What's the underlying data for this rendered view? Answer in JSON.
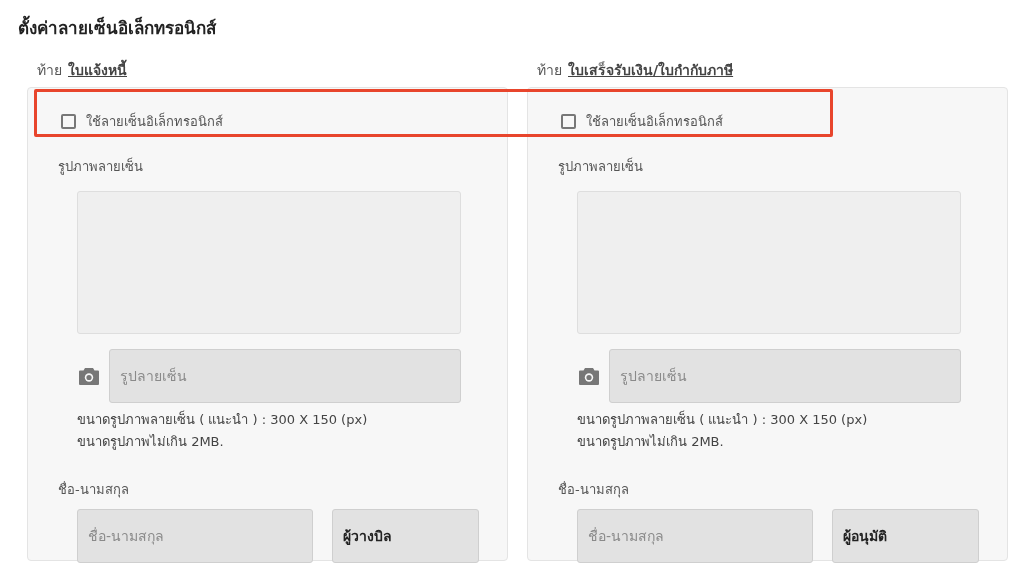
{
  "title": "ตั้งค่าลายเซ็นอิเล็กทรอนิกส์",
  "sections": [
    {
      "prefix": "ท้าย",
      "document": "ใบแจ้งหนี้",
      "use_signature": {
        "label": "ใช้ลายเซ็นอิเล็กทรอนิกส์",
        "checked": false
      },
      "image_label": "รูปภาพลายเซ็น",
      "image_field": {
        "placeholder": "รูปลายเซ็น"
      },
      "hints": [
        "ขนาดรูปภาพลายเซ็น ( แนะนำ ) : 300 X 150 (px)",
        "ขนาดรูปภาพไม่เกิน 2MB."
      ],
      "name_label": "ชื่อ-นามสกุล",
      "name_field": {
        "placeholder": "ชื่อ-นามสกุล"
      },
      "role_field": {
        "value": "ผู้วางบิล"
      }
    },
    {
      "prefix": "ท้าย",
      "document": "ใบเสร็จรับเงิน/ใบกำกับภาษี",
      "use_signature": {
        "label": "ใช้ลายเซ็นอิเล็กทรอนิกส์",
        "checked": false
      },
      "image_label": "รูปภาพลายเซ็น",
      "image_field": {
        "placeholder": "รูปลายเซ็น"
      },
      "hints": [
        "ขนาดรูปภาพลายเซ็น ( แนะนำ ) : 300 X 150 (px)",
        "ขนาดรูปภาพไม่เกิน 2MB."
      ],
      "name_label": "ชื่อ-นามสกุล",
      "name_field": {
        "placeholder": "ชื่อ-นามสกุล"
      },
      "role_field": {
        "value": "ผู้อนุมัติ"
      }
    }
  ]
}
